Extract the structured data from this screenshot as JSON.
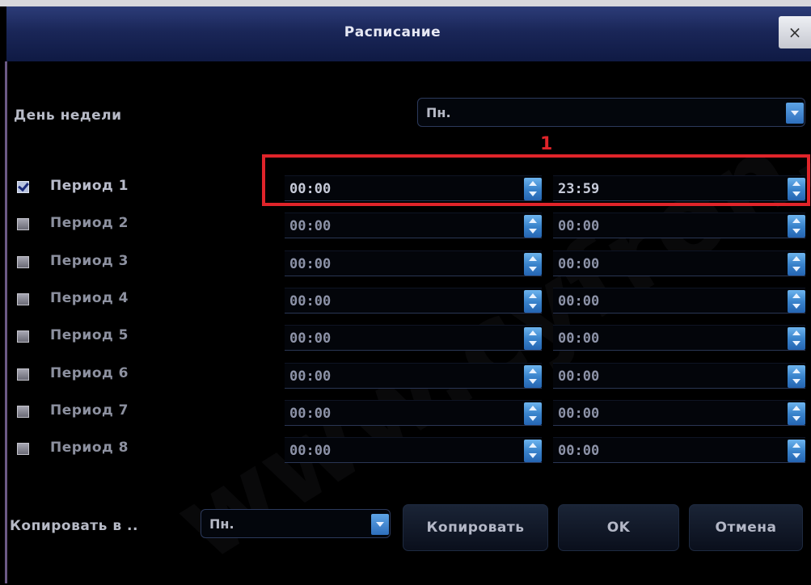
{
  "window": {
    "title": "Расписание",
    "close_glyph": "×"
  },
  "day_of_week": {
    "label": "День недели",
    "value": "Пн."
  },
  "annotation": "1",
  "periods": [
    {
      "label": "Период 1",
      "checked": true,
      "start": "00:00",
      "end": "23:59"
    },
    {
      "label": "Период 2",
      "checked": false,
      "start": "00:00",
      "end": "00:00"
    },
    {
      "label": "Период 3",
      "checked": false,
      "start": "00:00",
      "end": "00:00"
    },
    {
      "label": "Период 4",
      "checked": false,
      "start": "00:00",
      "end": "00:00"
    },
    {
      "label": "Период 5",
      "checked": false,
      "start": "00:00",
      "end": "00:00"
    },
    {
      "label": "Период 6",
      "checked": false,
      "start": "00:00",
      "end": "00:00"
    },
    {
      "label": "Период 7",
      "checked": false,
      "start": "00:00",
      "end": "00:00"
    },
    {
      "label": "Период 8",
      "checked": false,
      "start": "00:00",
      "end": "00:00"
    }
  ],
  "copy_to": {
    "label": "Копировать в ..",
    "value": "Пн."
  },
  "buttons": {
    "copy": "Копировать",
    "ok": "OK",
    "cancel": "Отмена"
  },
  "watermark": "www.cyfron.ru",
  "colors": {
    "highlight": "#e0242a",
    "spinner": "#3a84cc",
    "titlebar": "#1a2658"
  }
}
